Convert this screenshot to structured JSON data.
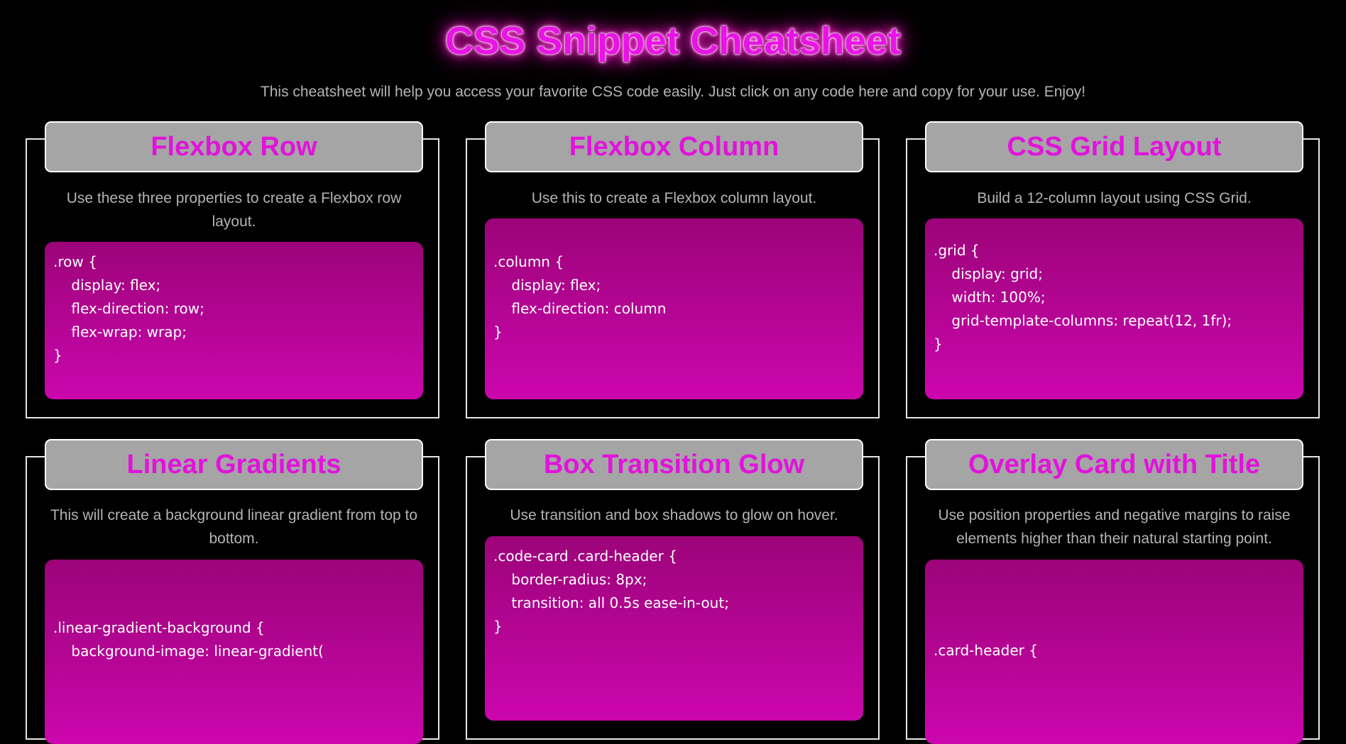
{
  "header": {
    "title": "CSS Snippet Cheatsheet",
    "subtitle": "This cheatsheet will help you access your favorite CSS code easily. Just click on any code here and copy for your use. Enjoy!"
  },
  "colors": {
    "background": "#000000",
    "accent": "#e212dc",
    "header_bg": "#a5a5a5",
    "code_gradient_top": "#9c0479",
    "code_gradient_bottom": "#cb06ad",
    "text_muted": "#b4b4b4"
  },
  "cards": [
    {
      "title": "Flexbox Row",
      "description": "Use these three properties to create a Flexbox row layout.",
      "code": ".row {\n    display: flex;\n    flex-direction: row;\n    flex-wrap: wrap;\n}"
    },
    {
      "title": "Flexbox Column",
      "description": "Use this to create a Flexbox column layout.",
      "code": ".column {\n    display: flex;\n    flex-direction: column\n}"
    },
    {
      "title": "CSS Grid Layout",
      "description": "Build a 12-column layout using CSS Grid.",
      "code": ".grid {\n    display: grid;\n    width: 100%;\n    grid-template-columns: repeat(12, 1fr);\n}"
    },
    {
      "title": "Linear Gradients",
      "description": "This will create a background linear gradient from top to bottom.",
      "code": ".linear-gradient-background {\n    background-image: linear-gradient("
    },
    {
      "title": "Box Transition Glow",
      "description": "Use transition and box shadows to glow on hover.",
      "code": ".code-card .card-header {\n    border-radius: 8px;\n    transition: all 0.5s ease-in-out;\n}"
    },
    {
      "title": "Overlay Card with Title",
      "description": "Use position properties and negative margins to raise elements higher than their natural starting point.",
      "code": ".card-header {"
    }
  ]
}
